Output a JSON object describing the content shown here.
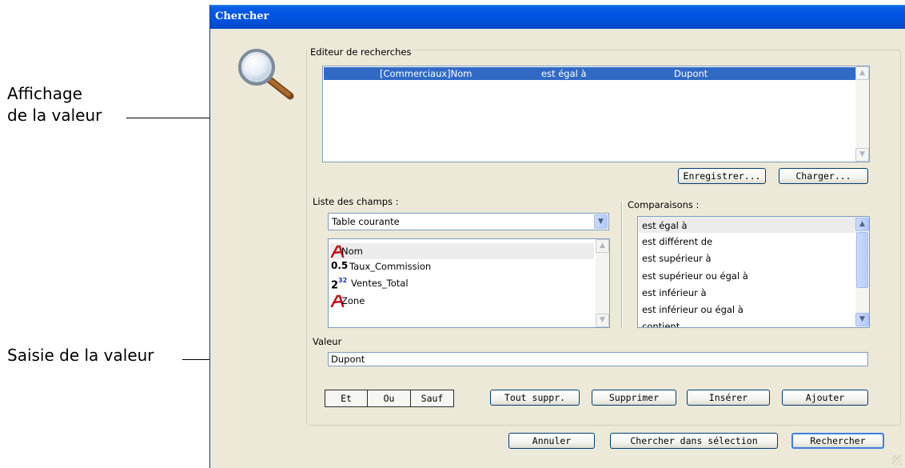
{
  "annotations": {
    "value_display_line1": "Affichage",
    "value_display_line2": "de la valeur",
    "value_entry": "Saisie de la valeur"
  },
  "window": {
    "title": "Chercher"
  },
  "search_editor": {
    "label": "Editeur de recherches",
    "rows": [
      {
        "field": "[Commerciaux]Nom",
        "operator": "est égal à",
        "value": "Dupont"
      }
    ],
    "save_label": "Enregistrer...",
    "load_label": "Charger..."
  },
  "fields": {
    "label": "Liste des champs :",
    "table_select": "Table courante",
    "items": [
      {
        "name": "Nom",
        "icon": "text-field-icon",
        "icon_glyph": "A"
      },
      {
        "name": "Taux_Commission",
        "icon": "real-field-icon",
        "icon_glyph": "0.5"
      },
      {
        "name": "Ventes_Total",
        "icon": "integer-field-icon",
        "icon_glyph": "2",
        "icon_sup": "32"
      },
      {
        "name": "Zone",
        "icon": "text-field-icon",
        "icon_glyph": "A"
      }
    ]
  },
  "comparisons": {
    "label": "Comparaisons :",
    "items": [
      "est égal à",
      "est différent de",
      "est supérieur à",
      "est supérieur ou égal à",
      "est inférieur à",
      "est inférieur ou égal à",
      "contient"
    ]
  },
  "value": {
    "label": "Valeur",
    "current": "Dupont"
  },
  "logic_buttons": {
    "and": "Et",
    "or": "Ou",
    "except": "Sauf"
  },
  "edit_buttons": {
    "clear_all": "Tout suppr.",
    "delete": "Supprimer",
    "insert": "Insérer",
    "add": "Ajouter"
  },
  "footer_buttons": {
    "cancel": "Annuler",
    "search_in_selection": "Chercher dans sélection",
    "search": "Rechercher"
  },
  "colors": {
    "selection": "#316ac5",
    "titlebar": "#0054e3",
    "dialog_bg": "#ece9d8",
    "text_field_icon": "#c0141c"
  }
}
